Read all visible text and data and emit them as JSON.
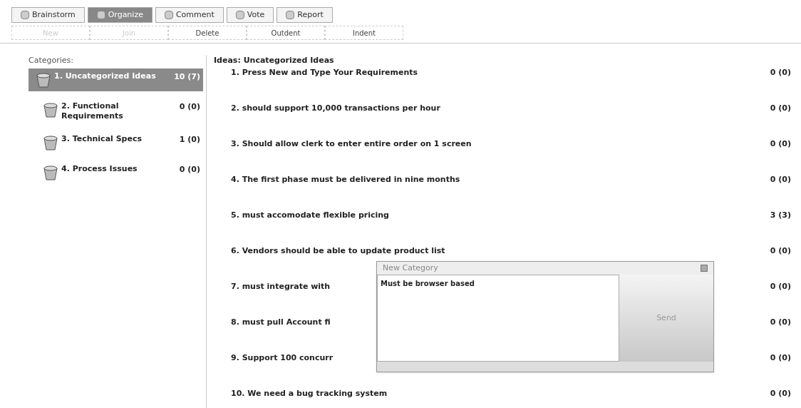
{
  "tabs": [
    {
      "label": "Brainstorm",
      "selected": false
    },
    {
      "label": "Organize",
      "selected": true
    },
    {
      "label": "Comment",
      "selected": false
    },
    {
      "label": "Vote",
      "selected": false
    },
    {
      "label": "Report",
      "selected": false
    }
  ],
  "toolbar": [
    {
      "label": "New",
      "disabled": true
    },
    {
      "label": "Join",
      "disabled": true
    },
    {
      "label": "Delete",
      "disabled": false
    },
    {
      "label": "Outdent",
      "disabled": false
    },
    {
      "label": "Indent",
      "disabled": false
    }
  ],
  "categories": {
    "title": "Categories:",
    "items": [
      {
        "label": "1. Uncategorized Ideas",
        "count": "10 (7)",
        "selected": true
      },
      {
        "label": "2. Functional Requirements",
        "count": "0 (0)",
        "selected": false
      },
      {
        "label": "3. Technical Specs",
        "count": "1 (0)",
        "selected": false
      },
      {
        "label": "4. Process Issues",
        "count": "0 (0)",
        "selected": false
      }
    ]
  },
  "ideas": {
    "title": "Ideas: Uncategorized Ideas",
    "items": [
      {
        "text": "1. Press New and Type Your Requirements",
        "count": "0 (0)"
      },
      {
        "text": "2. should support 10,000 transactions per hour",
        "count": "0 (0)"
      },
      {
        "text": "3. Should allow clerk to enter entire order on 1 screen",
        "count": "0 (0)"
      },
      {
        "text": "4. The first phase must be delivered in nine months",
        "count": "0 (0)"
      },
      {
        "text": "5. must accomodate flexible pricing",
        "count": "3 (3)"
      },
      {
        "text": "6. Vendors should be able to update product list",
        "count": "0 (0)"
      },
      {
        "text": "7. must integrate with",
        "count": "0 (0)"
      },
      {
        "text": "8. must pull Account  fi",
        "count": "0 (0)"
      },
      {
        "text": "9. Support 100 concurr",
        "count": "0 (0)"
      },
      {
        "text": "10. We need a bug tracking system",
        "count": "0 (0)"
      }
    ]
  },
  "dialog": {
    "title": "New Category",
    "value": "Must be browser based",
    "button": "Send"
  }
}
